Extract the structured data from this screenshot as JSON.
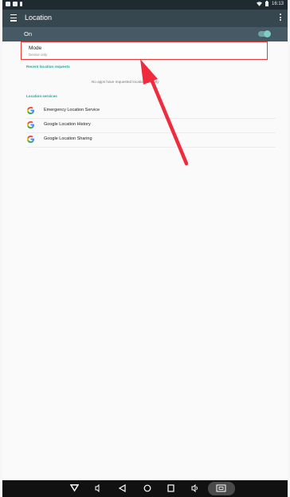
{
  "status_bar": {
    "time": "16:13"
  },
  "toolbar": {
    "title": "Location"
  },
  "location_switch": {
    "label": "On",
    "state": "on"
  },
  "mode": {
    "title": "Mode",
    "subtitle": "Device only"
  },
  "recent_requests": {
    "header": "Recent location requests",
    "empty_text": "No apps have requested location recently"
  },
  "services": {
    "header": "Location services",
    "items": [
      {
        "label": "Emergency Location Service",
        "icon": "google-g-icon"
      },
      {
        "label": "Google Location History",
        "icon": "google-g-icon"
      },
      {
        "label": "Google Location Sharing",
        "icon": "google-g-icon"
      }
    ]
  },
  "colors": {
    "toolbar": "#37474f",
    "on_bar": "#455a64",
    "accent": "#26a69a",
    "highlight": "#e53935"
  }
}
